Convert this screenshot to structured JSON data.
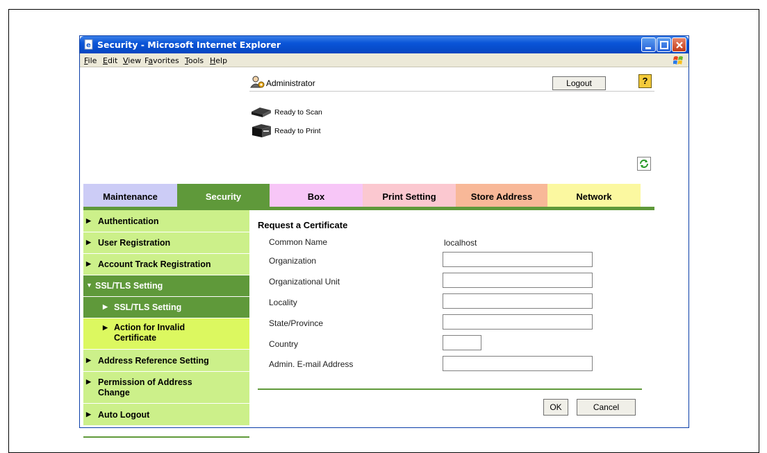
{
  "window": {
    "title": "Security - Microsoft Internet Explorer"
  },
  "menubar": {
    "items": [
      {
        "label": "File",
        "accel": "F",
        "rest": "ile"
      },
      {
        "label": "Edit",
        "accel": "E",
        "rest": "dit"
      },
      {
        "label": "View",
        "accel": "V",
        "rest": "iew"
      },
      {
        "label": "Favorites",
        "pre": "F",
        "accel": "a",
        "rest": "vorites"
      },
      {
        "label": "Tools",
        "accel": "T",
        "rest": "ools"
      },
      {
        "label": "Help",
        "accel": "H",
        "rest": "elp"
      }
    ]
  },
  "header": {
    "user": "Administrator",
    "logout_label": "Logout",
    "help_label": "?",
    "scan_status": "Ready to Scan",
    "print_status": "Ready to Print"
  },
  "tabs": [
    {
      "label": "Maintenance",
      "bg": "#ccccf6",
      "color": "#000000"
    },
    {
      "label": "Security",
      "bg": "#5f993a",
      "color": "#ffffff"
    },
    {
      "label": "Box",
      "bg": "#f7c6f7",
      "color": "#000000"
    },
    {
      "label": "Print Setting",
      "bg": "#fbc8d0",
      "color": "#000000"
    },
    {
      "label": "Store Address",
      "bg": "#f8b898",
      "color": "#000000"
    },
    {
      "label": "Network",
      "bg": "#fbf8a0",
      "color": "#000000"
    }
  ],
  "sidebar": {
    "items": [
      {
        "label": "Authentication",
        "arrow": "▶"
      },
      {
        "label": "User Registration",
        "arrow": "▶"
      },
      {
        "label": "Account Track Registration",
        "arrow": "▶"
      },
      {
        "label": "SSL/TLS Setting",
        "arrow": "▼"
      },
      {
        "label": "SSL/TLS Setting",
        "arrow": "▶"
      },
      {
        "label_line1": "Action for Invalid",
        "label_line2": "Certificate",
        "arrow": "▶"
      },
      {
        "label": "Address Reference Setting",
        "arrow": "▶"
      },
      {
        "label_line1": "Permission of Address",
        "label_line2": "Change",
        "arrow": "▶"
      },
      {
        "label": "Auto Logout",
        "arrow": "▶"
      }
    ]
  },
  "form": {
    "title": "Request a Certificate",
    "common_name_label": "Common Name",
    "common_name_value": "localhost",
    "organization_label": "Organization",
    "organization_value": "",
    "org_unit_label": "Organizational Unit",
    "org_unit_value": "",
    "locality_label": "Locality",
    "locality_value": "",
    "state_label": "State/Province",
    "state_value": "",
    "country_label": "Country",
    "country_value": "",
    "email_label": "Admin. E-mail Address",
    "email_value": "",
    "ok_label": "OK",
    "cancel_label": "Cancel"
  }
}
